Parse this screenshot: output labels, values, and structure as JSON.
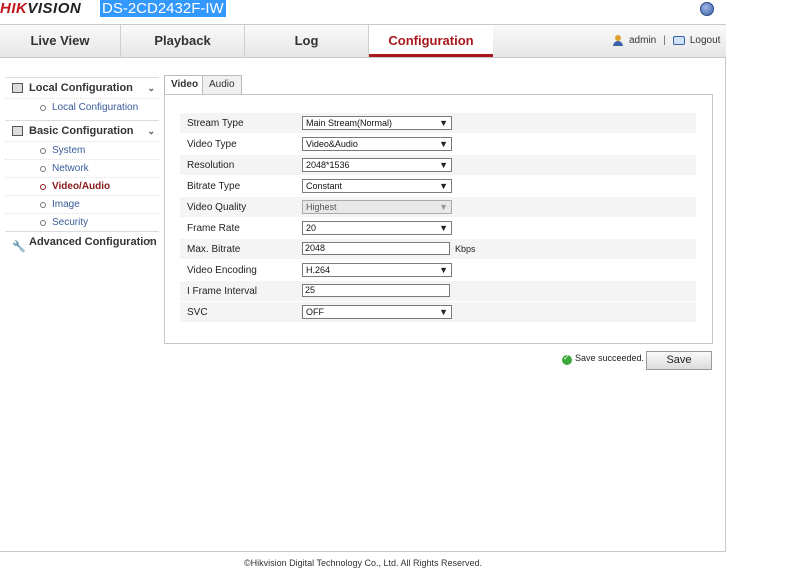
{
  "brand": {
    "logo_red": "HIK",
    "logo_dark": "VISION",
    "model": "DS-2CD2432F-IW"
  },
  "nav": {
    "tabs": [
      "Live View",
      "Playback",
      "Log",
      "Configuration"
    ],
    "active": "Configuration",
    "user": "admin",
    "logout": "Logout"
  },
  "sidebar": {
    "groups": [
      {
        "label": "Local Configuration",
        "items": [
          "Local Configuration"
        ]
      },
      {
        "label": "Basic Configuration",
        "items": [
          "System",
          "Network",
          "Video/Audio",
          "Image",
          "Security"
        ]
      },
      {
        "label": "Advanced Configuration",
        "items": []
      }
    ],
    "active_item": "Video/Audio"
  },
  "content": {
    "tabs": [
      "Video",
      "Audio"
    ],
    "active_tab": "Video",
    "fields": [
      {
        "label": "Stream Type",
        "value": "Main Stream(Normal)",
        "type": "select"
      },
      {
        "label": "Video Type",
        "value": "Video&Audio",
        "type": "select"
      },
      {
        "label": "Resolution",
        "value": "2048*1536",
        "type": "select"
      },
      {
        "label": "Bitrate Type",
        "value": "Constant",
        "type": "select"
      },
      {
        "label": "Video Quality",
        "value": "Highest",
        "type": "select",
        "disabled": true
      },
      {
        "label": "Frame Rate",
        "value": "20",
        "type": "select"
      },
      {
        "label": "Max. Bitrate",
        "value": "2048",
        "type": "text",
        "unit": "Kbps"
      },
      {
        "label": "Video Encoding",
        "value": "H.264",
        "type": "select"
      },
      {
        "label": "I Frame Interval",
        "value": "25",
        "type": "text"
      },
      {
        "label": "SVC",
        "value": "OFF",
        "type": "select"
      }
    ]
  },
  "status": {
    "message": "Save succeeded.",
    "color": "#3aa83a"
  },
  "save_label": "Save",
  "footer": "©Hikvision Digital Technology Co., Ltd. All Rights Reserved.",
  "colors": {
    "accent": "#a8171c",
    "link": "#3a5c9a",
    "model_bg": "#3399ff"
  }
}
